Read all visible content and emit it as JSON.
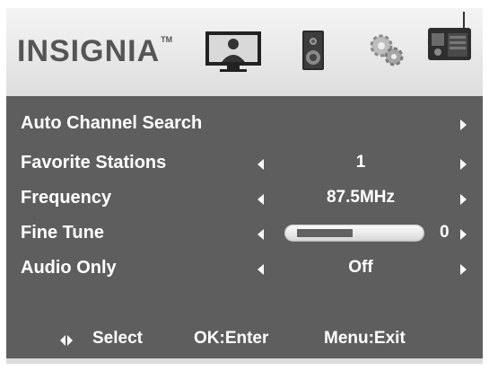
{
  "brand": {
    "name": "INSIGNIA",
    "trademark": "TM"
  },
  "header_icons": [
    "tv-picture-icon",
    "speaker-audio-icon",
    "gears-settings-icon",
    "radio-channel-icon"
  ],
  "menu": {
    "items": [
      {
        "label": "Auto Channel Search",
        "value": ""
      },
      {
        "label": "Favorite Stations",
        "value": "1"
      },
      {
        "label": "Frequency",
        "value": "87.5MHz"
      },
      {
        "label": "Fine Tune",
        "value": "0",
        "level": 0.4
      },
      {
        "label": "Audio Only",
        "value": "Off"
      }
    ]
  },
  "footer": {
    "select": "Select",
    "enter": "OK:Enter",
    "exit": "Menu:Exit"
  },
  "colors": {
    "panel": "#5e5e5e",
    "header": "#e8e8e8",
    "text": "#ffffff"
  }
}
